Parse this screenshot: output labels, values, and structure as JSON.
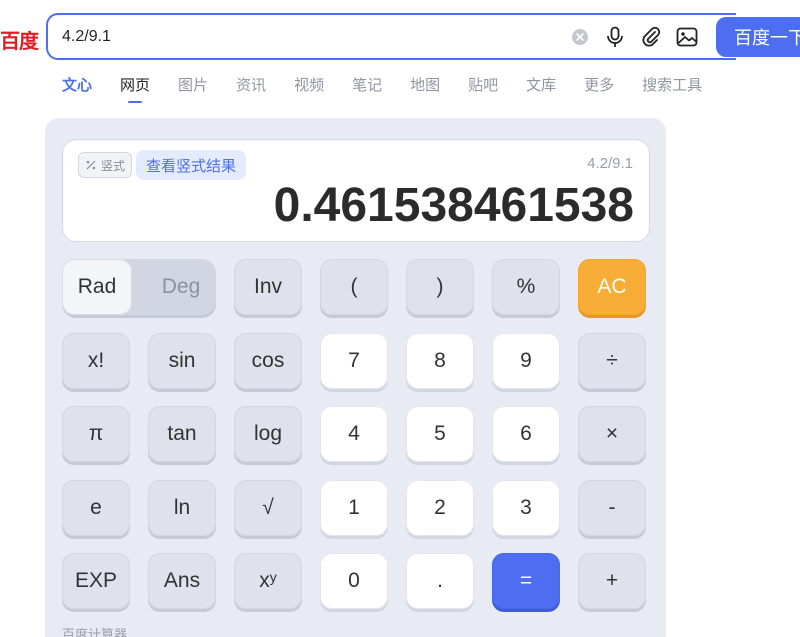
{
  "logo": "百度",
  "search": {
    "value": "4.2/9.1",
    "button_label": "百度一下"
  },
  "tabs": [
    {
      "label": "文心"
    },
    {
      "label": "网页"
    },
    {
      "label": "图片"
    },
    {
      "label": "资讯"
    },
    {
      "label": "视频"
    },
    {
      "label": "笔记"
    },
    {
      "label": "地图"
    },
    {
      "label": "贴吧"
    },
    {
      "label": "文库"
    },
    {
      "label": "更多"
    },
    {
      "label": "搜索工具"
    }
  ],
  "calculator": {
    "vertical_tag": "竖式",
    "vertical_link": "查看竖式结果",
    "expression": "4.2/9.1",
    "result": "0.461538461538",
    "rad_label": "Rad",
    "deg_label": "Deg",
    "keys": {
      "inv": "Inv",
      "lparen": "(",
      "rparen": ")",
      "percent": "%",
      "ac": "AC",
      "fact": "x!",
      "sin": "sin",
      "cos": "cos",
      "seven": "7",
      "eight": "8",
      "nine": "9",
      "divide": "÷",
      "pi": "π",
      "tan": "tan",
      "log": "log",
      "four": "4",
      "five": "5",
      "six": "6",
      "multiply": "×",
      "e": "e",
      "ln": "ln",
      "sqrt": "√",
      "one": "1",
      "two": "2",
      "three": "3",
      "minus": "-",
      "exp": "EXP",
      "ans": "Ans",
      "pow_base": "x",
      "pow_exp": "y",
      "zero": "0",
      "dot": ".",
      "equals": "=",
      "plus": "+"
    },
    "footer": "百度计算器"
  },
  "colors": {
    "brand_blue": "#4e6ef2",
    "logo_red": "#de1f27",
    "ac_orange": "#f8ad36"
  }
}
